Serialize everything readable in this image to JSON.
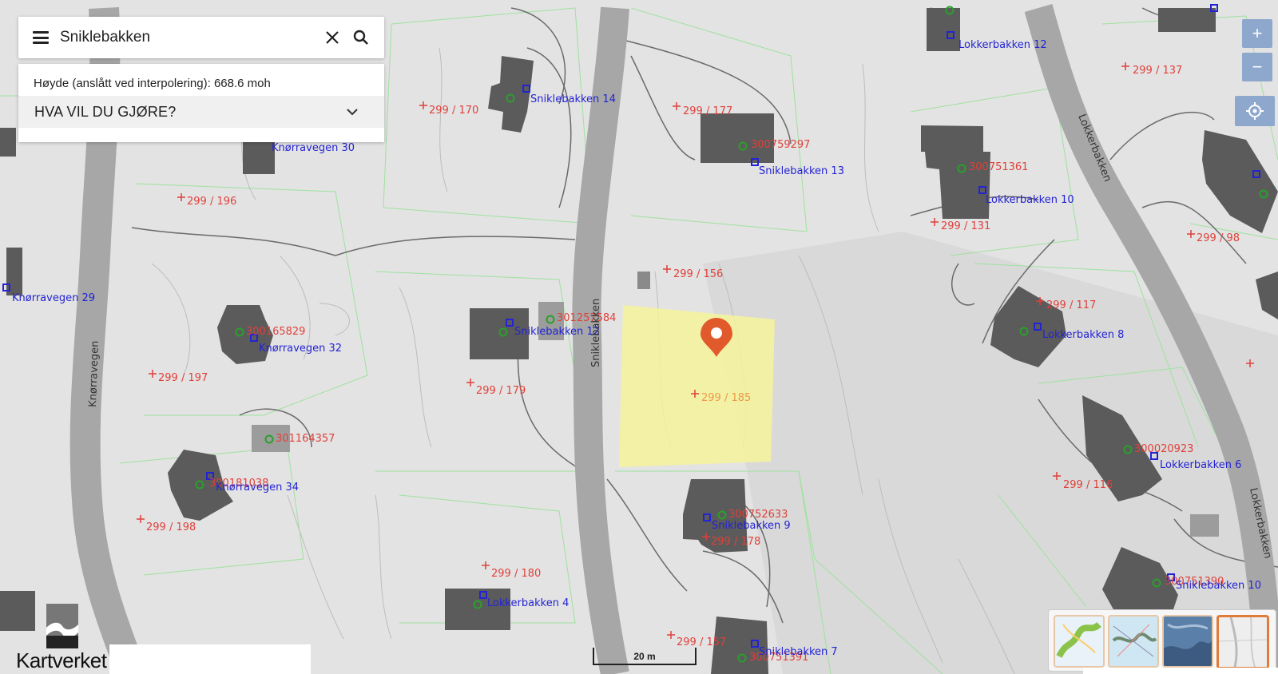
{
  "search": {
    "query": "Sniklebakken"
  },
  "panel": {
    "height_text": "Høyde (anslått ved interpolering): 668.6 moh",
    "action_label": "HVA VIL DU GJØRE?"
  },
  "zoom": {
    "in_label": "+",
    "out_label": "−"
  },
  "scale": {
    "label": "20 m"
  },
  "logo": {
    "text": "Kartverket"
  },
  "map": {
    "roads": [
      {
        "name": "Sniklebakken"
      },
      {
        "name": "Knørravegen"
      },
      {
        "name": "Lokkerbakken"
      },
      {
        "name": "Lokkerbakken"
      }
    ],
    "addresses": [
      "Lokkerbakken 12",
      "Sniklebakken 14",
      "Sniklebakken 13",
      "Lokkerbakken 10",
      "Knørravegen 30",
      "Knørravegen 29",
      "Knørravegen 32",
      "Sniklebakken 12",
      "Lokkerbakken 8",
      "Knørravegen 34",
      "Lokkerbakken 6",
      "Sniklebakken 9",
      "Sniklebakken 10",
      "Lokkerbakken 4",
      "Sniklebakken 7"
    ],
    "parcels": [
      "299 / 137",
      "299 / 170",
      "299 / 177",
      "299 / 196",
      "299 / 131",
      "299 / 98",
      "299 / 156",
      "299 / 117",
      "299 / 197",
      "299 / 179",
      "299 / 185",
      "299 / 116",
      "299 / 198",
      "299 / 178",
      "299 / 180",
      "299 / 157"
    ],
    "building_ids": [
      "300759297",
      "300751361",
      "301257584",
      "300165829",
      "301164357",
      "300752633",
      "300020923",
      "300181038",
      "300751390",
      "300751391"
    ],
    "colors": {
      "parcel_red": "#e0403a",
      "address_blue": "#2323d4",
      "building": "#555555",
      "highlight": "#f6f39a",
      "marker": "#e05a2b"
    }
  }
}
